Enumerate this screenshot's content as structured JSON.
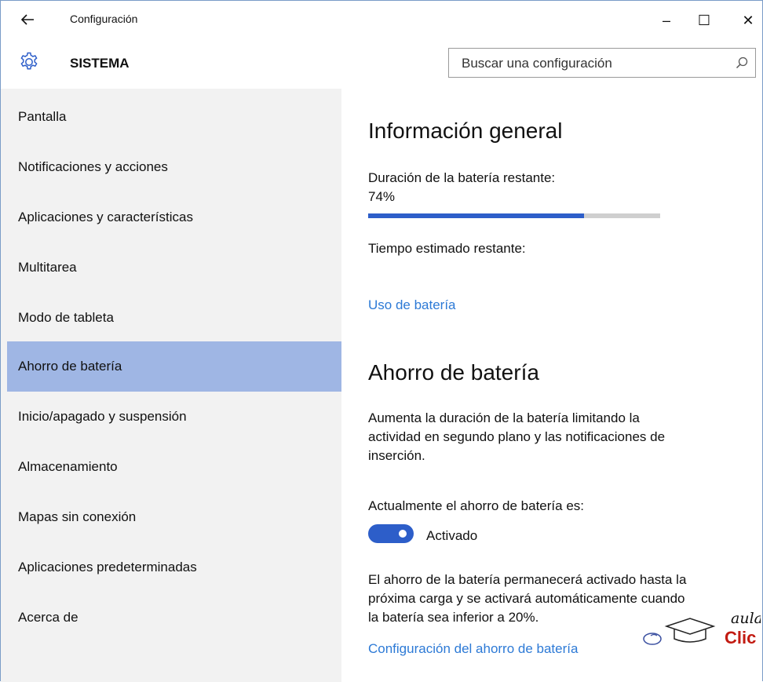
{
  "window": {
    "title": "Configuración",
    "controls": {
      "minimize": "–",
      "maximize": "☐",
      "close": "✕"
    }
  },
  "header": {
    "section": "SISTEMA",
    "search": {
      "placeholder": "Buscar una configuración",
      "value": ""
    }
  },
  "sidebar": {
    "selected_index": 5,
    "items": [
      {
        "label": "Pantalla"
      },
      {
        "label": "Notificaciones y acciones"
      },
      {
        "label": "Aplicaciones y características"
      },
      {
        "label": "Multitarea"
      },
      {
        "label": "Modo de tableta"
      },
      {
        "label": "Ahorro de batería"
      },
      {
        "label": "Inicio/apagado y suspensión"
      },
      {
        "label": "Almacenamiento"
      },
      {
        "label": "Mapas sin conexión"
      },
      {
        "label": "Aplicaciones predeterminadas"
      },
      {
        "label": "Acerca de"
      }
    ]
  },
  "main": {
    "overview": {
      "title": "Información general",
      "battery_label": "Duración de la batería restante:",
      "battery_percent_text": "74%",
      "battery_fraction": 0.74,
      "time_label": "Tiempo estimado restante:",
      "usage_link": "Uso de batería"
    },
    "saver": {
      "title": "Ahorro de batería",
      "description_lines": [
        "Aumenta la duración de la batería limitando la",
        "actividad en segundo plano y las notificaciones de",
        "inserción."
      ],
      "status_label": "Actualmente el ahorro de batería es:",
      "toggle_state": "Activado",
      "toggle_on": true,
      "info_lines": [
        "El ahorro de la batería permanecerá activado hasta la",
        "próxima carga y se activará automáticamente cuando",
        "la batería sea inferior a 20%."
      ],
      "settings_link": "Configuración del ahorro de batería"
    }
  },
  "watermark": {
    "line1": "aula",
    "line2": "Clic"
  },
  "colors": {
    "accent": "#2d5ec9",
    "link": "#2d7ad6",
    "sidebar_bg": "#f2f2f2",
    "selected_bg": "#9fb6e4"
  },
  "icons": [
    "back-arrow-icon",
    "gear-icon",
    "search-icon",
    "minimize-icon",
    "maximize-icon",
    "close-icon",
    "aulaclic-logo-icon"
  ]
}
